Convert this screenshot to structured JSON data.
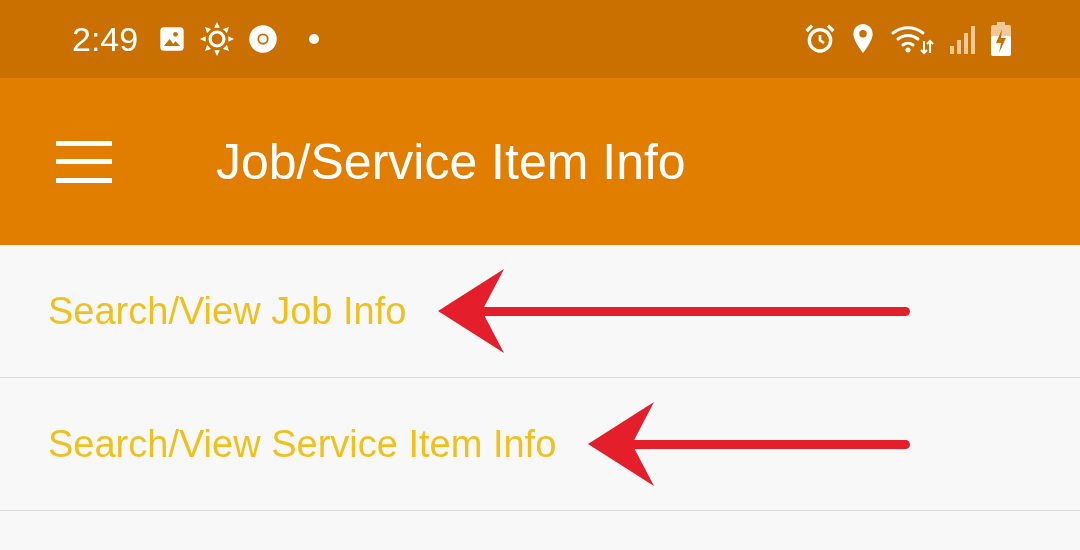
{
  "status_bar": {
    "time": "2:49"
  },
  "app_bar": {
    "title": "Job/Service Item Info"
  },
  "menu_items": [
    {
      "label": "Search/View Job Info",
      "marked": true
    },
    {
      "label": "Search/View Service Item Info",
      "marked": true
    }
  ]
}
